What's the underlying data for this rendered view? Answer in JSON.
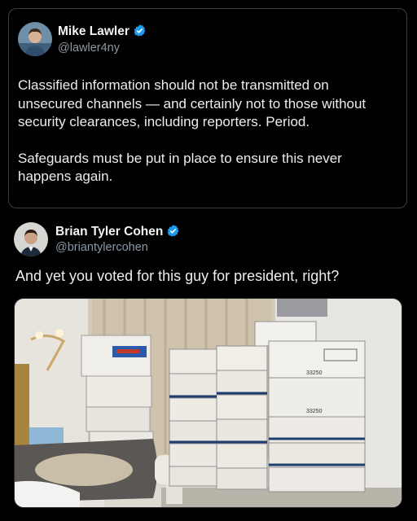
{
  "quoted_post": {
    "author_name": "Mike Lawler",
    "author_handle": "@lawler4ny",
    "verified": true,
    "paragraphs": [
      "Classified information should not be transmitted on unsecured channels — and certainly not to those without security clearances, including reporters. Period.",
      "Safeguards must be put in place to ensure this never happens again."
    ]
  },
  "reply_post": {
    "author_name": "Brian Tyler Cohen",
    "author_handle": "@briantylercohen",
    "verified": true,
    "text": "And yet you voted for this guy for president, right?"
  },
  "media": {
    "box_labels": [
      "33250",
      "33250"
    ]
  },
  "colors": {
    "background": "#000000",
    "verified_badge": "#1d9bf0",
    "handle_text": "#8b98a5",
    "card_border": "#3a3f45"
  },
  "icons": [
    "verified-badge-icon"
  ]
}
